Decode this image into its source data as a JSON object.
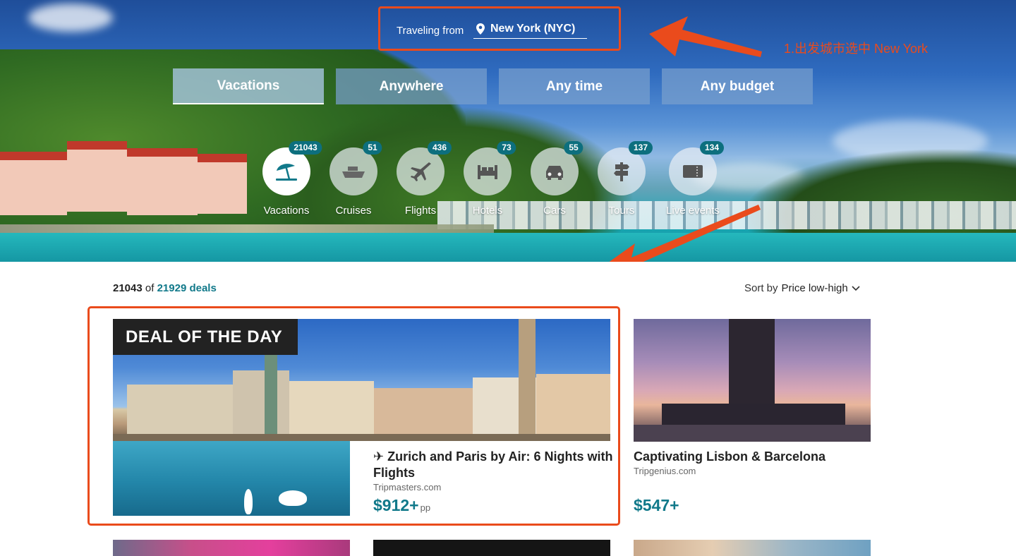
{
  "hero": {
    "traveling_from_label": "Traveling from",
    "origin_city": "New York (NYC)",
    "annotation_text": "1.出发城市选中 New York",
    "tabs": [
      {
        "label": "Vacations",
        "active": true
      },
      {
        "label": "Anywhere",
        "active": false
      },
      {
        "label": "Any time",
        "active": false
      },
      {
        "label": "Any budget",
        "active": false
      }
    ],
    "categories": [
      {
        "label": "Vacations",
        "count": "21043",
        "icon": "beach-umbrella-icon",
        "active": true
      },
      {
        "label": "Cruises",
        "count": "51",
        "icon": "cruise-ship-icon",
        "active": false
      },
      {
        "label": "Flights",
        "count": "436",
        "icon": "airplane-icon",
        "active": false
      },
      {
        "label": "Hotels",
        "count": "73",
        "icon": "bed-icon",
        "active": false
      },
      {
        "label": "Cars",
        "count": "55",
        "icon": "car-icon",
        "active": false
      },
      {
        "label": "Tours",
        "count": "137",
        "icon": "signpost-icon",
        "active": false
      },
      {
        "label": "Live events",
        "count": "134",
        "icon": "ticket-icon",
        "active": false
      }
    ]
  },
  "results": {
    "shown": "21043",
    "of_word": "of",
    "total": "21929 deals",
    "sort_label": "Sort by",
    "sort_value": "Price low-high"
  },
  "deal_of_day": {
    "badge": "DEAL OF THE DAY",
    "title": "✈ Zurich and Paris by Air: 6 Nights with Flights",
    "source": "Tripmasters.com",
    "price": "$912+",
    "price_unit": "pp"
  },
  "card2": {
    "title": "Captivating Lisbon & Barcelona",
    "source": "Tripgenius.com",
    "price": "$547+"
  },
  "colors": {
    "accent_teal": "#11798a",
    "annotation_red": "#ea4b1c",
    "badge_teal": "#0d6f7e"
  }
}
